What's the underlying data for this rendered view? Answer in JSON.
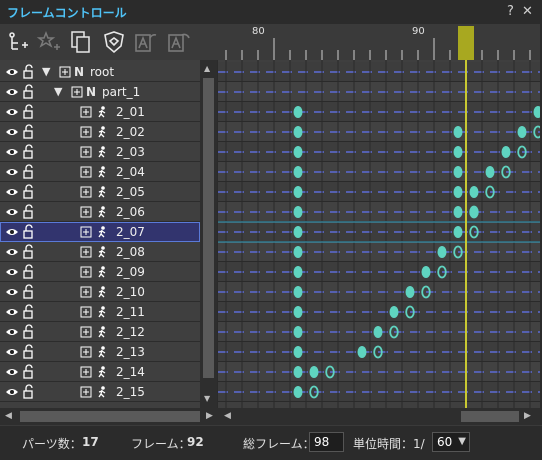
{
  "window": {
    "title": "フレームコントロール",
    "help": "?",
    "close": "✕"
  },
  "toolbar": {
    "buttons": [
      "add-part-icon",
      "star-icon",
      "copy-icon",
      "shield-icon",
      "text-a-icon",
      "text-a-redo-icon"
    ]
  },
  "ruler": {
    "labels": [
      "80",
      "90"
    ],
    "current_frame": 92,
    "first_visible_frame": 77
  },
  "tree": {
    "rows": [
      {
        "label": "root",
        "kind": "node",
        "indent": 0,
        "expanded": true
      },
      {
        "label": "part_1",
        "kind": "node",
        "indent": 1,
        "expanded": true
      },
      {
        "label": "2_01",
        "kind": "part"
      },
      {
        "label": "2_02",
        "kind": "part"
      },
      {
        "label": "2_03",
        "kind": "part"
      },
      {
        "label": "2_04",
        "kind": "part"
      },
      {
        "label": "2_05",
        "kind": "part"
      },
      {
        "label": "2_06",
        "kind": "part"
      },
      {
        "label": "2_07",
        "kind": "part",
        "selected": true
      },
      {
        "label": "2_08",
        "kind": "part"
      },
      {
        "label": "2_09",
        "kind": "part"
      },
      {
        "label": "2_10",
        "kind": "part"
      },
      {
        "label": "2_11",
        "kind": "part"
      },
      {
        "label": "2_12",
        "kind": "part"
      },
      {
        "label": "2_13",
        "kind": "part"
      },
      {
        "label": "2_14",
        "kind": "part"
      },
      {
        "label": "2_15",
        "kind": "part"
      }
    ]
  },
  "keyframes": {
    "note_frames": "each row: frames with filled key (f) and hollow key (h)",
    "rows": [
      {
        "f": [],
        "h": []
      },
      {
        "f": [],
        "h": []
      },
      {
        "f": [
          81,
          96
        ],
        "h": [
          97
        ]
      },
      {
        "f": [
          81,
          91,
          95
        ],
        "h": [
          96
        ]
      },
      {
        "f": [
          81,
          91,
          94
        ],
        "h": [
          95
        ]
      },
      {
        "f": [
          81,
          91,
          93
        ],
        "h": [
          94
        ]
      },
      {
        "f": [
          81,
          91,
          92
        ],
        "h": [
          93
        ]
      },
      {
        "f": [
          81,
          91,
          92
        ],
        "h": [
          92
        ]
      },
      {
        "f": [
          81,
          91
        ],
        "h": [
          92
        ]
      },
      {
        "f": [
          81,
          90
        ],
        "h": [
          91
        ]
      },
      {
        "f": [
          81,
          89
        ],
        "h": [
          90
        ]
      },
      {
        "f": [
          81,
          88
        ],
        "h": [
          89
        ]
      },
      {
        "f": [
          81,
          87
        ],
        "h": [
          88
        ]
      },
      {
        "f": [
          81,
          86
        ],
        "h": [
          87
        ]
      },
      {
        "f": [
          81,
          85
        ],
        "h": [
          86
        ]
      },
      {
        "f": [
          81,
          82
        ],
        "h": [
          83
        ]
      },
      {
        "f": [
          81
        ],
        "h": [
          82
        ]
      }
    ]
  },
  "status": {
    "parts_label": "パーツ数：",
    "parts_value": "17",
    "frame_label": "フレーム：",
    "frame_value": "92",
    "total_label": "総フレーム：",
    "total_value": "98",
    "unit_label": "単位時間：1/",
    "unit_value": "60"
  },
  "colors": {
    "accent_title": "#4fc3f7",
    "key_fill": "#5fd4c0",
    "playhead": "#c8c832",
    "selection": "#32346e"
  }
}
